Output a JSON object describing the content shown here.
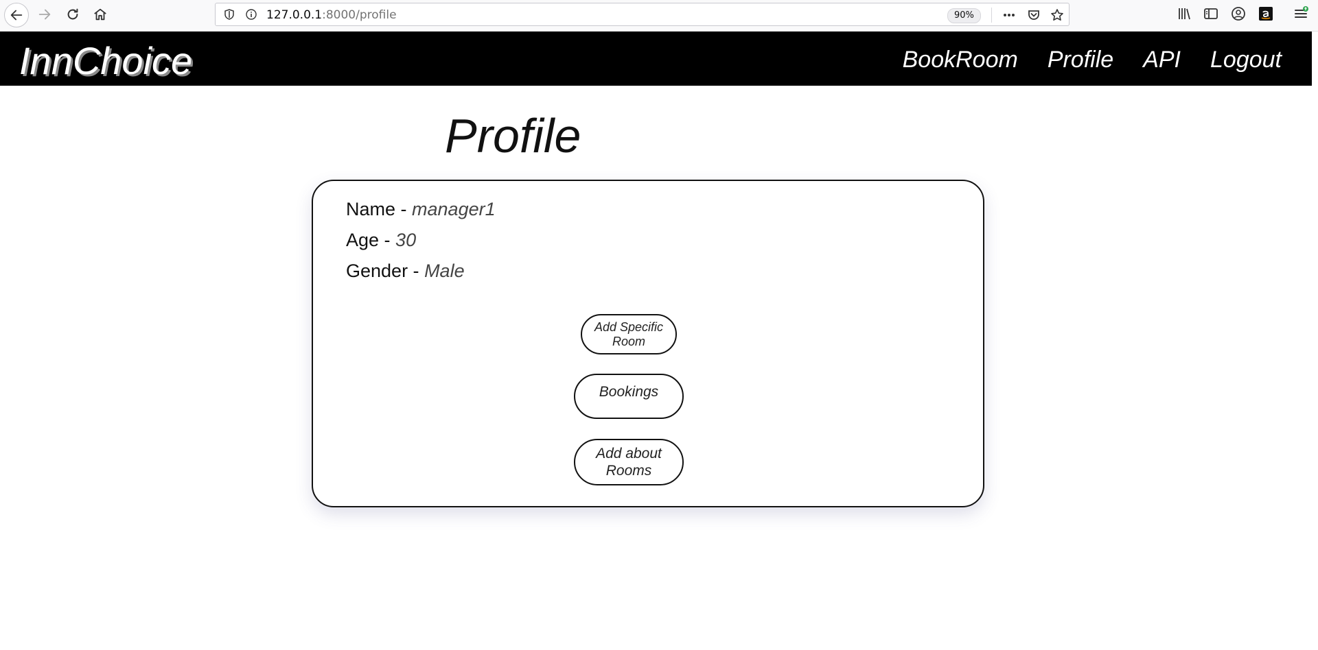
{
  "browser": {
    "url_host": "127.0.0.1",
    "url_rest": ":8000/profile",
    "zoom": "90%"
  },
  "header": {
    "brand": "InnChoice",
    "nav": [
      "BookRoom",
      "Profile",
      "API",
      "Logout"
    ]
  },
  "page": {
    "title": "Profile"
  },
  "profile": {
    "name_label": "Name - ",
    "name_value": "manager1",
    "age_label": "Age - ",
    "age_value": "30",
    "gender_label": "Gender - ",
    "gender_value": "Male"
  },
  "actions": {
    "add_specific_room": "Add Specific Room",
    "bookings": "Bookings",
    "add_about_rooms": "Add about Rooms"
  }
}
